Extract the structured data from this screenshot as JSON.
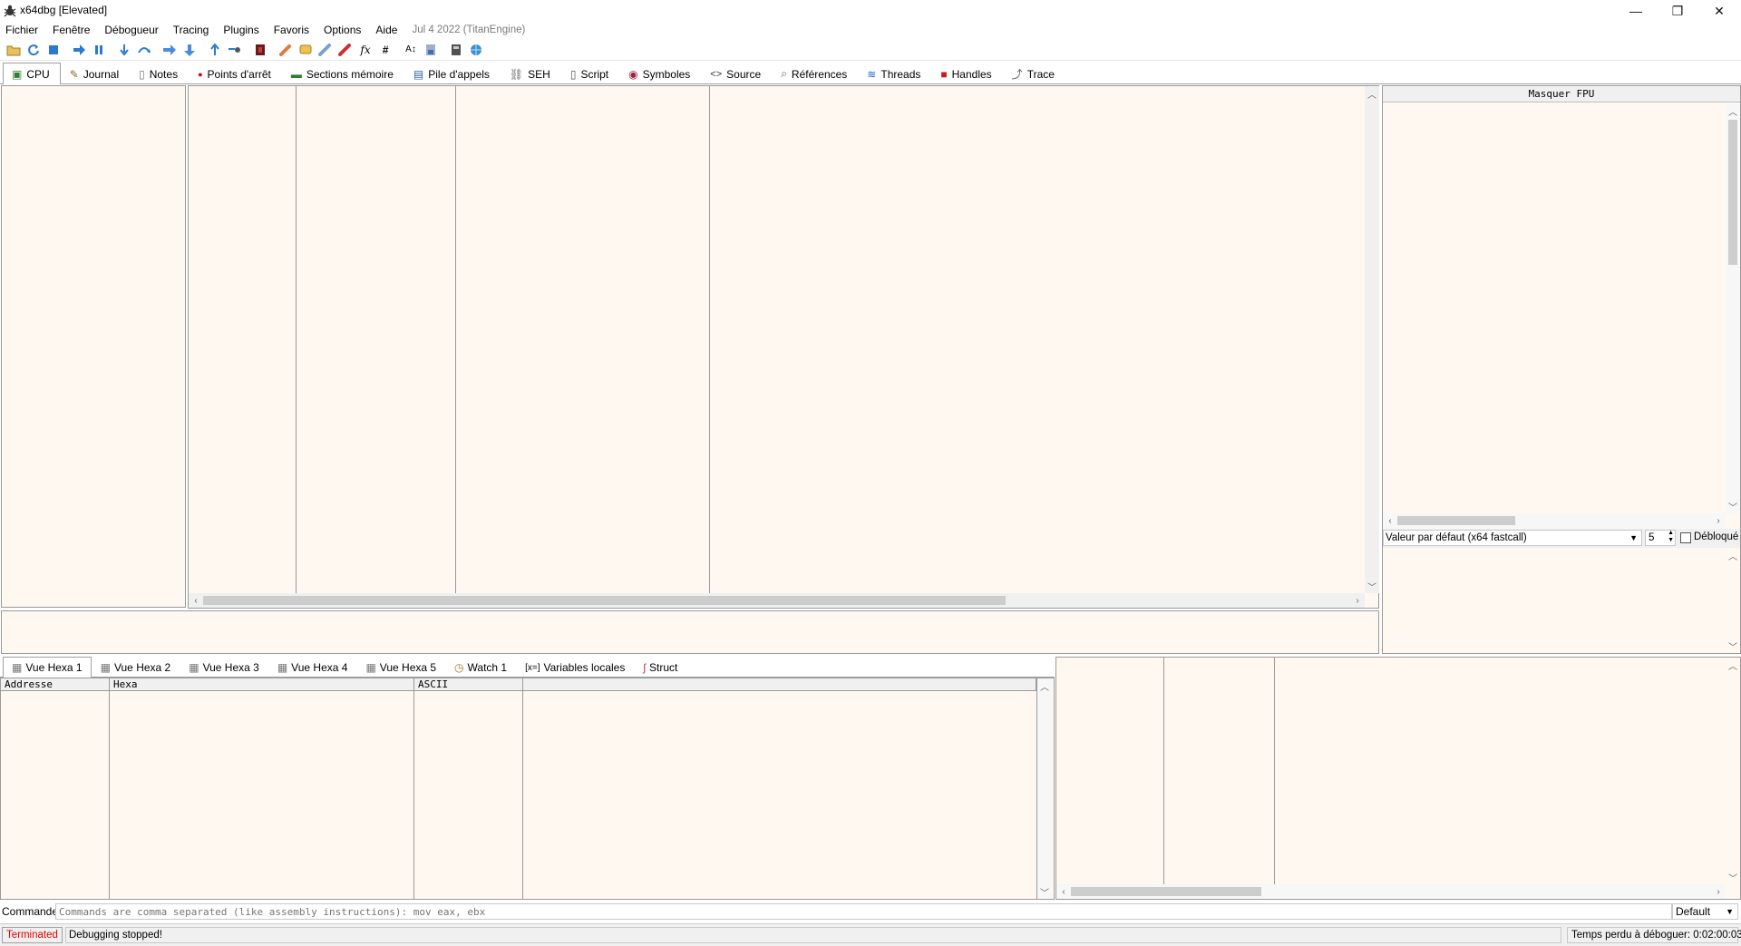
{
  "window": {
    "title": "x64dbg [Elevated]",
    "minimize": "—",
    "restore": "❐",
    "close": "✕"
  },
  "menu": {
    "items": [
      "Fichier",
      "Fenêtre",
      "Débogueur",
      "Tracing",
      "Plugins",
      "Favoris",
      "Options",
      "Aide"
    ],
    "build": "Jul 4 2022 (TitanEngine)"
  },
  "toolbar": {
    "hash_label": "#",
    "fx_label": "fx",
    "font_label": "A↕"
  },
  "main_tabs": [
    {
      "label": "CPU",
      "icon": "cpu-icon",
      "glyph": "▣",
      "color": "#2e7d32"
    },
    {
      "label": "Journal",
      "icon": "journal-icon",
      "glyph": "✎",
      "color": "#555555"
    },
    {
      "label": "Notes",
      "icon": "notes-icon",
      "glyph": "🗎",
      "color": "#555555"
    },
    {
      "label": "Points d'arrêt",
      "icon": "breakpoint-icon",
      "glyph": "●",
      "color": "#d00000"
    },
    {
      "label": "Sections mémoire",
      "icon": "memory-icon",
      "glyph": "▬",
      "color": "#2e7d32"
    },
    {
      "label": "Pile d'appels",
      "icon": "callstack-icon",
      "glyph": "▤",
      "color": "#3060a0"
    },
    {
      "label": "SEH",
      "icon": "seh-icon",
      "glyph": "⛓",
      "color": "#666666"
    },
    {
      "label": "Script",
      "icon": "script-icon",
      "glyph": "⟨⟩",
      "color": "#555555"
    },
    {
      "label": "Symboles",
      "icon": "symbols-icon",
      "glyph": "◉",
      "color": "#a02040"
    },
    {
      "label": "Source",
      "icon": "source-icon",
      "glyph": "<>",
      "color": "#333333"
    },
    {
      "label": "Références",
      "icon": "references-icon",
      "glyph": "⌕",
      "color": "#555555"
    },
    {
      "label": "Threads",
      "icon": "threads-icon",
      "glyph": "≋",
      "color": "#2060c0"
    },
    {
      "label": "Handles",
      "icon": "handles-icon",
      "glyph": "■",
      "color": "#c02020"
    },
    {
      "label": "Trace",
      "icon": "trace-icon",
      "glyph": "⤴",
      "color": "#555555"
    }
  ],
  "registers": {
    "hide_fpu": "Masquer FPU",
    "calling_convention": "Valeur par défaut (x64 fastcall)",
    "arg_count": "5",
    "unlocked_label": "Débloqué"
  },
  "dump_tabs": [
    {
      "label": "Vue Hexa 1",
      "icon": "dump-icon"
    },
    {
      "label": "Vue Hexa 2",
      "icon": "dump-icon"
    },
    {
      "label": "Vue Hexa 3",
      "icon": "dump-icon"
    },
    {
      "label": "Vue Hexa 4",
      "icon": "dump-icon"
    },
    {
      "label": "Vue Hexa 5",
      "icon": "dump-icon"
    },
    {
      "label": "Watch 1",
      "icon": "watch-icon"
    },
    {
      "label": "Variables locales",
      "icon": "locals-icon"
    },
    {
      "label": "Struct",
      "icon": "struct-icon"
    }
  ],
  "dump_columns": [
    "Addresse",
    "Hexa",
    "ASCII",
    ""
  ],
  "command": {
    "label": "Commande:",
    "placeholder": "Commands are comma separated (like assembly instructions): mov eax, ebx",
    "mode": "Default"
  },
  "status": {
    "state": "Terminated",
    "message": "Debugging stopped!",
    "time_wasted": "Temps perdu à déboguer: 0:02:00:03"
  }
}
